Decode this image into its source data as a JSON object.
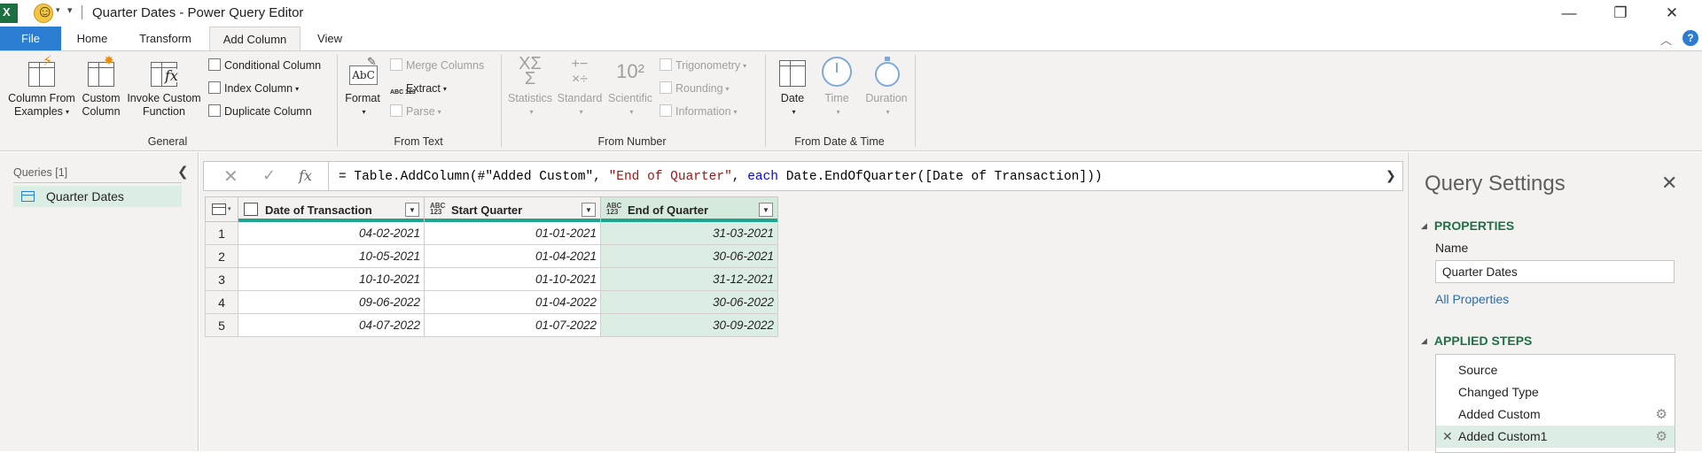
{
  "window": {
    "title": "Quarter Dates - Power Query Editor",
    "minimize_glyph": "—",
    "restore_glyph": "❐",
    "close_glyph": "✕"
  },
  "ribbon_tabs": [
    "File",
    "Home",
    "Transform",
    "Add Column",
    "View"
  ],
  "active_tab": "Add Column",
  "ribbon": {
    "general": {
      "label": "General",
      "column_from_examples": [
        "Column From",
        "Examples"
      ],
      "custom_column": [
        "Custom",
        "Column"
      ],
      "invoke_custom_function": [
        "Invoke Custom",
        "Function"
      ],
      "conditional_column": "Conditional Column",
      "index_column": "Index Column",
      "duplicate_column": "Duplicate Column"
    },
    "from_text": {
      "label": "From Text",
      "format": "Format",
      "merge_columns": "Merge Columns",
      "extract": "Extract",
      "parse": "Parse"
    },
    "from_number": {
      "label": "From Number",
      "statistics": "Statistics",
      "standard": "Standard",
      "scientific": "Scientific",
      "trigonometry": "Trigonometry",
      "rounding": "Rounding",
      "information": "Information"
    },
    "from_date_time": {
      "label": "From Date & Time",
      "date": "Date",
      "time": "Time",
      "duration": "Duration"
    }
  },
  "queries_panel": {
    "header": "Queries [1]",
    "items": [
      "Quarter Dates"
    ]
  },
  "formula_bar": {
    "part1": "= Table.AddColumn(#\"Added Custom\", ",
    "string1": "\"End of Quarter\"",
    "part2": ", ",
    "keyword": "each",
    "part3": " Date.EndOfQuarter([Date of Transaction]))"
  },
  "table": {
    "columns": [
      {
        "label": "Date of Transaction",
        "type_icon": "calendar-icon"
      },
      {
        "label": "Start Quarter",
        "type_icon": "ABC\n123"
      },
      {
        "label": "End of Quarter",
        "type_icon": "ABC\n123"
      }
    ],
    "rows": [
      [
        "1",
        "04-02-2021",
        "01-01-2021",
        "31-03-2021"
      ],
      [
        "2",
        "10-05-2021",
        "01-04-2021",
        "30-06-2021"
      ],
      [
        "3",
        "10-10-2021",
        "01-10-2021",
        "31-12-2021"
      ],
      [
        "4",
        "09-06-2022",
        "01-04-2022",
        "30-06-2022"
      ],
      [
        "5",
        "04-07-2022",
        "01-07-2022",
        "30-09-2022"
      ]
    ]
  },
  "query_settings": {
    "title": "Query Settings",
    "properties_header": "PROPERTIES",
    "name_label": "Name",
    "name_value": "Quarter Dates",
    "all_properties_link": "All Properties",
    "applied_steps_header": "APPLIED STEPS",
    "steps": [
      "Source",
      "Changed Type",
      "Added Custom",
      "Added Custom1"
    ]
  },
  "colors": {
    "accent_green": "#1e7145",
    "selection_green": "#dceee4",
    "file_tab_blue": "#2b7cd3",
    "quality_bar_teal": "#1fa58f"
  }
}
